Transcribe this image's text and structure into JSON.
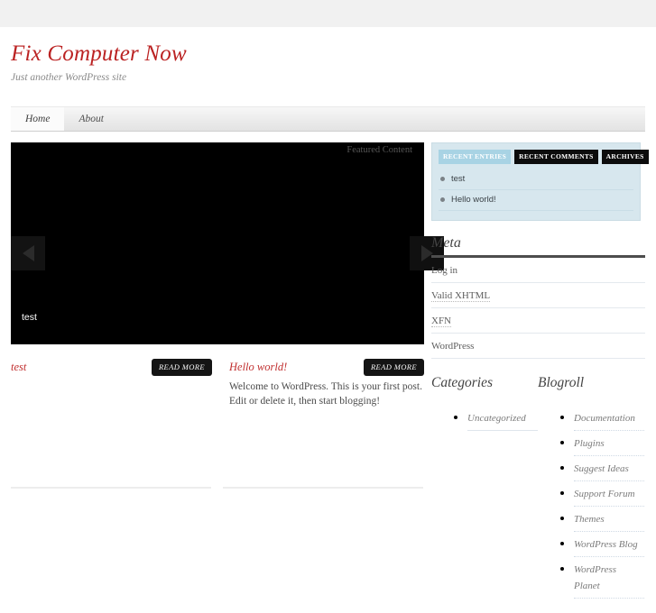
{
  "header": {
    "site_title": "Fix Computer Now",
    "tagline": "Just another WordPress site"
  },
  "nav": {
    "items": [
      {
        "label": "Home",
        "active": true
      },
      {
        "label": "About",
        "active": false
      }
    ]
  },
  "slider": {
    "featured_label": "Featured Content",
    "caption": "test",
    "prev_icon": "arrow-left-icon",
    "next_icon": "arrow-right-icon"
  },
  "posts": [
    {
      "title": "test",
      "excerpt": "",
      "read_more": "READ MORE"
    },
    {
      "title": "Hello world!",
      "excerpt": "Welcome to WordPress. This is your first post. Edit or delete it, then start blogging!",
      "read_more": "READ MORE"
    }
  ],
  "sidebar": {
    "tab_widget": {
      "tabs": [
        {
          "label": "RECENT ENTRIES",
          "active": true
        },
        {
          "label": "RECENT COMMENTS",
          "active": false
        },
        {
          "label": "ARCHIVES",
          "active": false
        }
      ],
      "entries": [
        {
          "label": "test"
        },
        {
          "label": "Hello world!"
        }
      ]
    },
    "meta": {
      "title": "Meta",
      "items": [
        {
          "label": "Log in",
          "dotted": false
        },
        {
          "label": "Valid XHTML",
          "dotted": true
        },
        {
          "label": "XFN",
          "dotted": true
        },
        {
          "label": "WordPress",
          "dotted": false
        }
      ]
    },
    "categories": {
      "title": "Categories",
      "items": [
        {
          "label": "Uncategorized"
        }
      ]
    },
    "blogroll": {
      "title": "Blogroll",
      "items": [
        {
          "label": "Documentation"
        },
        {
          "label": "Plugins"
        },
        {
          "label": "Suggest Ideas"
        },
        {
          "label": "Support Forum"
        },
        {
          "label": "Themes"
        },
        {
          "label": "WordPress Blog"
        },
        {
          "label": "WordPress Planet"
        }
      ]
    }
  },
  "colors": {
    "accent_red": "#bb2222",
    "tab_active_blue": "#a8d3e4",
    "widget_bg_blue": "#d7e7ee",
    "slider_black": "#000000"
  }
}
